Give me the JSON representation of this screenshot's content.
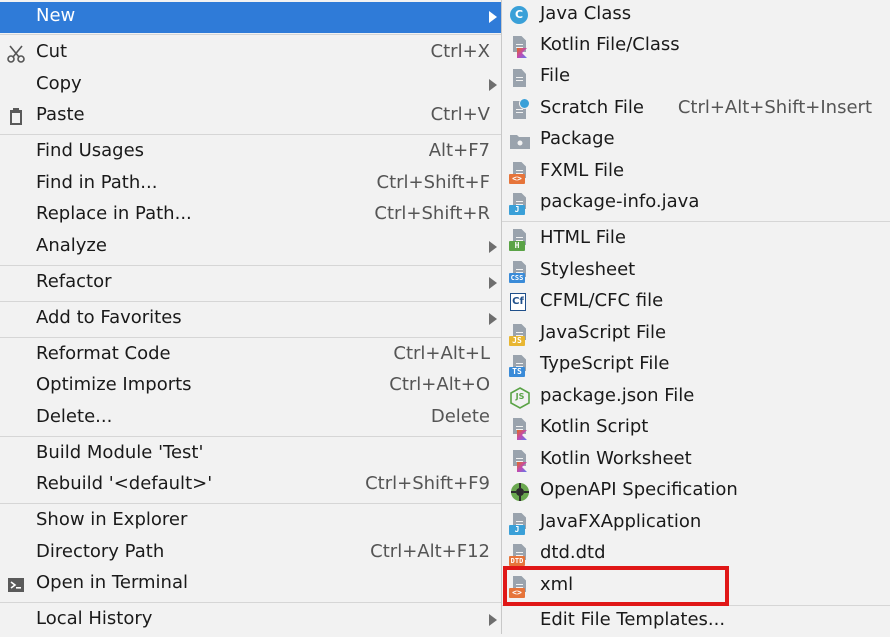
{
  "context_menu": {
    "items": [
      {
        "label": "New",
        "shortcut": ""
      },
      {
        "label": "Cut",
        "shortcut": "Ctrl+X"
      },
      {
        "label": "Copy",
        "shortcut": ""
      },
      {
        "label": "Paste",
        "shortcut": "Ctrl+V"
      },
      {
        "label": "Find Usages",
        "shortcut": "Alt+F7"
      },
      {
        "label": "Find in Path...",
        "shortcut": "Ctrl+Shift+F"
      },
      {
        "label": "Replace in Path...",
        "shortcut": "Ctrl+Shift+R"
      },
      {
        "label": "Analyze",
        "shortcut": ""
      },
      {
        "label": "Refactor",
        "shortcut": ""
      },
      {
        "label": "Add to Favorites",
        "shortcut": ""
      },
      {
        "label": "Reformat Code",
        "shortcut": "Ctrl+Alt+L"
      },
      {
        "label": "Optimize Imports",
        "shortcut": "Ctrl+Alt+O"
      },
      {
        "label": "Delete...",
        "shortcut": "Delete"
      },
      {
        "label": "Build Module 'Test'",
        "shortcut": ""
      },
      {
        "label": "Rebuild '<default>'",
        "shortcut": "Ctrl+Shift+F9"
      },
      {
        "label": "Show in Explorer",
        "shortcut": ""
      },
      {
        "label": "Directory Path",
        "shortcut": "Ctrl+Alt+F12"
      },
      {
        "label": "Open in Terminal",
        "shortcut": ""
      },
      {
        "label": "Local History",
        "shortcut": ""
      }
    ]
  },
  "new_submenu": {
    "items": [
      {
        "label": "Java Class",
        "shortcut": "",
        "badge": "C"
      },
      {
        "label": "Kotlin File/Class",
        "shortcut": "",
        "badge": ""
      },
      {
        "label": "File",
        "shortcut": "",
        "badge": ""
      },
      {
        "label": "Scratch File",
        "shortcut": "Ctrl+Alt+Shift+Insert",
        "badge": ""
      },
      {
        "label": "Package",
        "shortcut": "",
        "badge": ""
      },
      {
        "label": "FXML File",
        "shortcut": "",
        "badge": "<>"
      },
      {
        "label": "package-info.java",
        "shortcut": "",
        "badge": "J"
      },
      {
        "label": "HTML File",
        "shortcut": "",
        "badge": "H"
      },
      {
        "label": "Stylesheet",
        "shortcut": "",
        "badge": "CSS"
      },
      {
        "label": "CFML/CFC file",
        "shortcut": "",
        "badge": "Cf"
      },
      {
        "label": "JavaScript File",
        "shortcut": "",
        "badge": "JS"
      },
      {
        "label": "TypeScript File",
        "shortcut": "",
        "badge": "TS"
      },
      {
        "label": "package.json File",
        "shortcut": "",
        "badge": "JS"
      },
      {
        "label": "Kotlin Script",
        "shortcut": "",
        "badge": ""
      },
      {
        "label": "Kotlin Worksheet",
        "shortcut": "",
        "badge": ""
      },
      {
        "label": "OpenAPI Specification",
        "shortcut": "",
        "badge": ""
      },
      {
        "label": "JavaFXApplication",
        "shortcut": "",
        "badge": "J"
      },
      {
        "label": "dtd.dtd",
        "shortcut": "",
        "badge": "DTD"
      },
      {
        "label": "xml",
        "shortcut": "",
        "badge": "<>"
      },
      {
        "label": "Edit File Templates...",
        "shortcut": "",
        "badge": ""
      }
    ]
  },
  "colors": {
    "selection": "#2f7bd8",
    "highlight_box": "#e01717"
  }
}
